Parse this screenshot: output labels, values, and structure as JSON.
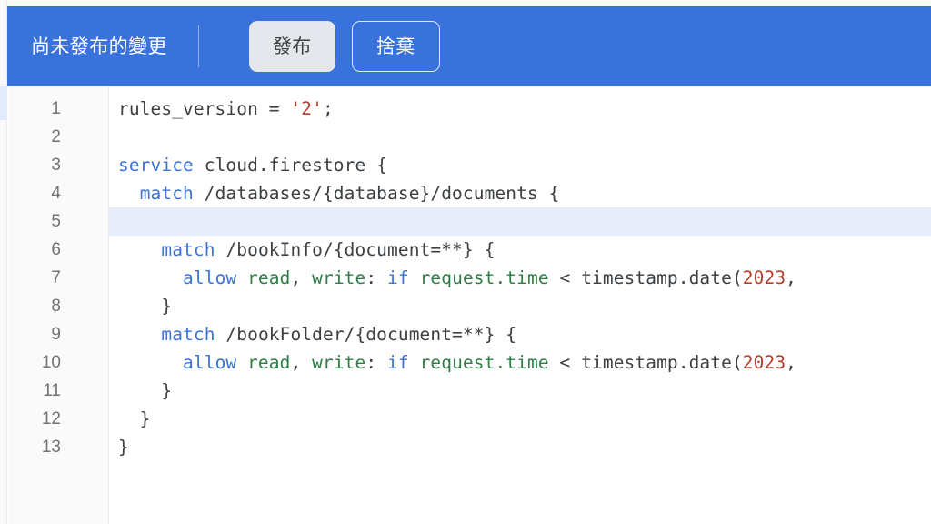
{
  "banner": {
    "title": "尚未發布的變更",
    "publish_label": "發布",
    "discard_label": "捨棄",
    "background_color": "#3a72dc",
    "publish_bg_color": "#e4e8ec"
  },
  "editor": {
    "highlighted_line": 5,
    "highlight_color": "#e7edfb",
    "gutter_bg_color": "#fafafa",
    "line_numbers": [
      "1",
      "2",
      "3",
      "4",
      "5",
      "6",
      "7",
      "8",
      "9",
      "10",
      "11",
      "12",
      "13"
    ],
    "lines": [
      {
        "number": "1",
        "text": "rules_version = '2';",
        "tokens": [
          {
            "t": "rules_version = ",
            "c": "tok-pln"
          },
          {
            "t": "'2'",
            "c": "tok-str"
          },
          {
            "t": ";",
            "c": "tok-pln"
          }
        ]
      },
      {
        "number": "2",
        "text": "",
        "tokens": []
      },
      {
        "number": "3",
        "text": "service cloud.firestore {",
        "tokens": [
          {
            "t": "service",
            "c": "tok-kw"
          },
          {
            "t": " cloud.firestore {",
            "c": "tok-pln"
          }
        ]
      },
      {
        "number": "4",
        "text": "  match /databases/{database}/documents {",
        "tokens": [
          {
            "t": "  ",
            "c": "tok-pln"
          },
          {
            "t": "match",
            "c": "tok-kw"
          },
          {
            "t": " /databases/{database}/documents {",
            "c": "tok-pln"
          }
        ]
      },
      {
        "number": "5",
        "text": "",
        "tokens": []
      },
      {
        "number": "6",
        "text": "    match /bookInfo/{document=**} {",
        "tokens": [
          {
            "t": "    ",
            "c": "tok-pln"
          },
          {
            "t": "match",
            "c": "tok-kw"
          },
          {
            "t": " /bookInfo/{document=**} {",
            "c": "tok-pln"
          }
        ]
      },
      {
        "number": "7",
        "text": "      allow read, write: if request.time < timestamp.date(2023,",
        "tokens": [
          {
            "t": "      ",
            "c": "tok-pln"
          },
          {
            "t": "allow",
            "c": "tok-kw"
          },
          {
            "t": " ",
            "c": "tok-pln"
          },
          {
            "t": "read",
            "c": "tok-fn"
          },
          {
            "t": ", ",
            "c": "tok-pln"
          },
          {
            "t": "write",
            "c": "tok-fn"
          },
          {
            "t": ": ",
            "c": "tok-pln"
          },
          {
            "t": "if",
            "c": "tok-kw"
          },
          {
            "t": " ",
            "c": "tok-pln"
          },
          {
            "t": "request.time",
            "c": "tok-fn"
          },
          {
            "t": " < timestamp.date(",
            "c": "tok-pln"
          },
          {
            "t": "2023",
            "c": "tok-num"
          },
          {
            "t": ",",
            "c": "tok-pln"
          }
        ]
      },
      {
        "number": "8",
        "text": "    }",
        "tokens": [
          {
            "t": "    }",
            "c": "tok-pln"
          }
        ]
      },
      {
        "number": "9",
        "text": "    match /bookFolder/{document=**} {",
        "tokens": [
          {
            "t": "    ",
            "c": "tok-pln"
          },
          {
            "t": "match",
            "c": "tok-kw"
          },
          {
            "t": " /bookFolder/{document=**} {",
            "c": "tok-pln"
          }
        ]
      },
      {
        "number": "10",
        "text": "      allow read, write: if request.time < timestamp.date(2023,",
        "tokens": [
          {
            "t": "      ",
            "c": "tok-pln"
          },
          {
            "t": "allow",
            "c": "tok-kw"
          },
          {
            "t": " ",
            "c": "tok-pln"
          },
          {
            "t": "read",
            "c": "tok-fn"
          },
          {
            "t": ", ",
            "c": "tok-pln"
          },
          {
            "t": "write",
            "c": "tok-fn"
          },
          {
            "t": ": ",
            "c": "tok-pln"
          },
          {
            "t": "if",
            "c": "tok-kw"
          },
          {
            "t": " ",
            "c": "tok-pln"
          },
          {
            "t": "request.time",
            "c": "tok-fn"
          },
          {
            "t": " < timestamp.date(",
            "c": "tok-pln"
          },
          {
            "t": "2023",
            "c": "tok-num"
          },
          {
            "t": ",",
            "c": "tok-pln"
          }
        ]
      },
      {
        "number": "11",
        "text": "    }",
        "tokens": [
          {
            "t": "    }",
            "c": "tok-pln"
          }
        ]
      },
      {
        "number": "12",
        "text": "  }",
        "tokens": [
          {
            "t": "  }",
            "c": "tok-pln"
          }
        ]
      },
      {
        "number": "13",
        "text": "}",
        "tokens": [
          {
            "t": "}",
            "c": "tok-pln"
          }
        ]
      }
    ]
  }
}
